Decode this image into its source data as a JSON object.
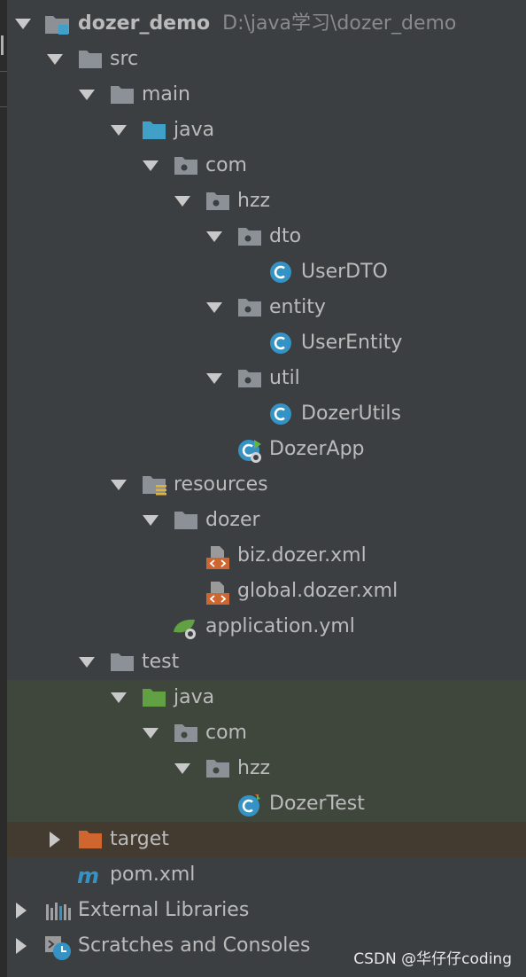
{
  "colors": {
    "panel_bg": "#3c3f41",
    "text": "#bbbbbb",
    "folder_gray": "#8c9197",
    "source_folder_blue": "#40a0c8",
    "test_folder_green": "#62a044",
    "excluded_folder_orange": "#d0662f",
    "class_icon": "#3592c4",
    "test_highlight": "#3f473d",
    "excluded_highlight": "#433b30"
  },
  "tree": {
    "project": {
      "name": "dozer_demo",
      "path": "D:\\java学习\\dozer_demo",
      "icon": "project-folder-icon"
    },
    "src": "src",
    "main": "main",
    "main_java": "java",
    "main_com": "com",
    "main_hzz": "hzz",
    "dto": "dto",
    "user_dto": "UserDTO",
    "entity": "entity",
    "user_entity": "UserEntity",
    "util": "util",
    "dozer_utils": "DozerUtils",
    "dozer_app": "DozerApp",
    "resources": "resources",
    "dozer_dir": "dozer",
    "biz_xml": "biz.dozer.xml",
    "global_xml": "global.dozer.xml",
    "application_yml": "application.yml",
    "test": "test",
    "test_java": "java",
    "test_com": "com",
    "test_hzz": "hzz",
    "dozer_test": "DozerTest",
    "target": "target",
    "pom": "pom.xml",
    "external_libraries": "External Libraries",
    "scratches": "Scratches and Consoles"
  },
  "watermark": "CSDN @华仔仔coding"
}
